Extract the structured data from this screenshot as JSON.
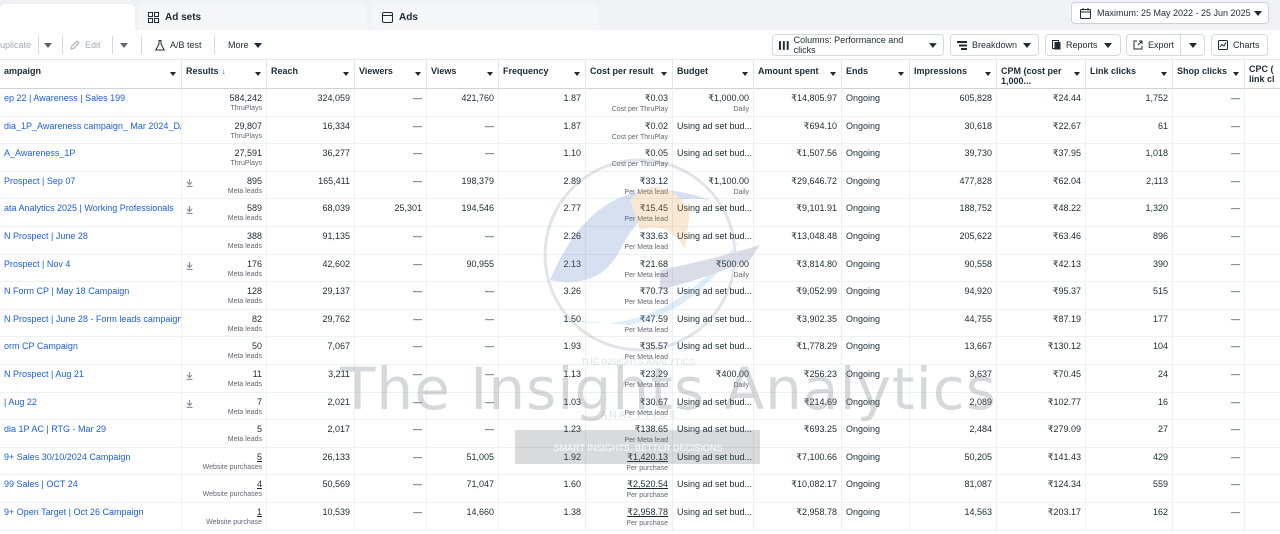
{
  "tabs": [
    {
      "label": "Ad sets",
      "icon": "grid-icon"
    },
    {
      "label": "Ads",
      "icon": "ad-icon"
    }
  ],
  "date_range": "Maximum: 25 May 2022 - 25 Jun 2025",
  "toolbar": {
    "duplicate": "uplicate",
    "edit": "Edit",
    "ab_test": "A/B test",
    "more": "More",
    "columns": "Columns: Performance and clicks",
    "breakdown": "Breakdown",
    "reports": "Reports",
    "export": "Export",
    "charts": "Charts"
  },
  "columns": [
    {
      "label": "ampaign"
    },
    {
      "label": "Results",
      "sort": "↓"
    },
    {
      "label": "Reach"
    },
    {
      "label": "Viewers"
    },
    {
      "label": "Views"
    },
    {
      "label": "Frequency"
    },
    {
      "label": "Cost per result"
    },
    {
      "label": "Budget"
    },
    {
      "label": "Amount spent"
    },
    {
      "label": "Ends"
    },
    {
      "label": "Impressions"
    },
    {
      "label": "CPM (cost per 1,000..."
    },
    {
      "label": "Link clicks"
    },
    {
      "label": "Shop clicks"
    },
    {
      "label": "CPC (\nlink cl"
    }
  ],
  "rows": [
    {
      "name": "ep 22 | Awareness | Sales 199",
      "lead": false,
      "results": "584,242",
      "results_sub": "ThruPlays",
      "reach": "324,059",
      "viewers": "—",
      "views": "421,760",
      "frequency": "1.87",
      "cpr": "₹0.03",
      "cpr_sub": "Cost per ThruPlay",
      "budget": "₹1,000.00",
      "budget_sub": "Daily",
      "spent": "₹14,805.97",
      "ends": "Ongoing",
      "impressions": "605,828",
      "cpm": "₹24.44",
      "link_clicks": "1,752",
      "shop_clicks": "—",
      "underline": false
    },
    {
      "name": "dia_1P_Awareness campaign_ Mar 2024_DA",
      "lead": false,
      "results": "29,807",
      "results_sub": "ThruPlays",
      "reach": "16,334",
      "viewers": "—",
      "views": "—",
      "frequency": "1.87",
      "cpr": "₹0.02",
      "cpr_sub": "Cost per ThruPlay",
      "budget": "Using ad set bud...",
      "budget_sub": "",
      "spent": "₹694.10",
      "ends": "Ongoing",
      "impressions": "30,618",
      "cpm": "₹22.67",
      "link_clicks": "61",
      "shop_clicks": "—",
      "underline": false
    },
    {
      "name": "A_Awareness_1P",
      "lead": false,
      "results": "27,591",
      "results_sub": "ThruPlays",
      "reach": "36,277",
      "viewers": "—",
      "views": "—",
      "frequency": "1.10",
      "cpr": "₹0.05",
      "cpr_sub": "Cost per ThruPlay",
      "budget": "Using ad set bud...",
      "budget_sub": "",
      "spent": "₹1,507.56",
      "ends": "Ongoing",
      "impressions": "39,730",
      "cpm": "₹37.95",
      "link_clicks": "1,018",
      "shop_clicks": "—",
      "underline": false
    },
    {
      "name": "Prospect | Sep 07",
      "lead": true,
      "results": "895",
      "results_sub": "Meta leads",
      "reach": "165,411",
      "viewers": "—",
      "views": "198,379",
      "frequency": "2.89",
      "cpr": "₹33.12",
      "cpr_sub": "Per Meta lead",
      "budget": "₹1,100.00",
      "budget_sub": "Daily",
      "spent": "₹29,646.72",
      "ends": "Ongoing",
      "impressions": "477,828",
      "cpm": "₹62.04",
      "link_clicks": "2,113",
      "shop_clicks": "—",
      "underline": false
    },
    {
      "name": "ata Analytics 2025 | Working Professionals",
      "lead": true,
      "results": "589",
      "results_sub": "Meta leads",
      "reach": "68,039",
      "viewers": "25,301",
      "views": "194,546",
      "frequency": "2.77",
      "cpr": "₹15.45",
      "cpr_sub": "Per Meta lead",
      "budget": "Using ad set bud...",
      "budget_sub": "",
      "spent": "₹9,101.91",
      "ends": "Ongoing",
      "impressions": "188,752",
      "cpm": "₹48.22",
      "link_clicks": "1,320",
      "shop_clicks": "—",
      "underline": false
    },
    {
      "name": "N Prospect | June 28",
      "lead": false,
      "results": "388",
      "results_sub": "Meta leads",
      "reach": "91,135",
      "viewers": "—",
      "views": "—",
      "frequency": "2.26",
      "cpr": "₹33.63",
      "cpr_sub": "Per Meta lead",
      "budget": "Using ad set bud...",
      "budget_sub": "",
      "spent": "₹13,048.48",
      "ends": "Ongoing",
      "impressions": "205,622",
      "cpm": "₹63.46",
      "link_clicks": "896",
      "shop_clicks": "—",
      "underline": false
    },
    {
      "name": "Prospect | Nov 4",
      "lead": true,
      "results": "176",
      "results_sub": "Meta leads",
      "reach": "42,602",
      "viewers": "—",
      "views": "90,955",
      "frequency": "2.13",
      "cpr": "₹21.68",
      "cpr_sub": "Per Meta lead",
      "budget": "₹500.00",
      "budget_sub": "Daily",
      "spent": "₹3,814.80",
      "ends": "Ongoing",
      "impressions": "90,558",
      "cpm": "₹42.13",
      "link_clicks": "390",
      "shop_clicks": "—",
      "underline": false
    },
    {
      "name": "N Form CP | May 18 Campaign",
      "lead": false,
      "results": "128",
      "results_sub": "Meta leads",
      "reach": "29,137",
      "viewers": "—",
      "views": "—",
      "frequency": "3.26",
      "cpr": "₹70.73",
      "cpr_sub": "Per Meta lead",
      "budget": "Using ad set bud...",
      "budget_sub": "",
      "spent": "₹9,052.99",
      "ends": "Ongoing",
      "impressions": "94,920",
      "cpm": "₹95.37",
      "link_clicks": "515",
      "shop_clicks": "—",
      "underline": false
    },
    {
      "name": "N Prospect | June 28 - Form leads campaign -...",
      "lead": false,
      "results": "82",
      "results_sub": "Meta leads",
      "reach": "29,762",
      "viewers": "—",
      "views": "—",
      "frequency": "1.50",
      "cpr": "₹47.59",
      "cpr_sub": "Per Meta lead",
      "budget": "Using ad set bud...",
      "budget_sub": "",
      "spent": "₹3,902.35",
      "ends": "Ongoing",
      "impressions": "44,755",
      "cpm": "₹87.19",
      "link_clicks": "177",
      "shop_clicks": "—",
      "underline": false
    },
    {
      "name": "orm CP Campaign",
      "lead": false,
      "results": "50",
      "results_sub": "Meta leads",
      "reach": "7,067",
      "viewers": "—",
      "views": "—",
      "frequency": "1.93",
      "cpr": "₹35.57",
      "cpr_sub": "Per Meta lead",
      "budget": "Using ad set bud...",
      "budget_sub": "",
      "spent": "₹1,778.29",
      "ends": "Ongoing",
      "impressions": "13,667",
      "cpm": "₹130.12",
      "link_clicks": "104",
      "shop_clicks": "—",
      "underline": false
    },
    {
      "name": "N Prospect | Aug 21",
      "lead": true,
      "results": "11",
      "results_sub": "Meta leads",
      "reach": "3,211",
      "viewers": "—",
      "views": "—",
      "frequency": "1.13",
      "cpr": "₹23.29",
      "cpr_sub": "Per Meta lead",
      "budget": "₹400.00",
      "budget_sub": "Daily",
      "spent": "₹256.23",
      "ends": "Ongoing",
      "impressions": "3,637",
      "cpm": "₹70.45",
      "link_clicks": "24",
      "shop_clicks": "—",
      "underline": false
    },
    {
      "name": "| Aug 22",
      "lead": true,
      "results": "7",
      "results_sub": "Meta leads",
      "reach": "2,021",
      "viewers": "—",
      "views": "—",
      "frequency": "1.03",
      "cpr": "₹30.67",
      "cpr_sub": "Per Meta lead",
      "budget": "Using ad set bud...",
      "budget_sub": "",
      "spent": "₹214.69",
      "ends": "Ongoing",
      "impressions": "2,089",
      "cpm": "₹102.77",
      "link_clicks": "16",
      "shop_clicks": "—",
      "underline": false
    },
    {
      "name": "dia 1P AC | RTG - Mar 29",
      "lead": false,
      "results": "5",
      "results_sub": "Meta leads",
      "reach": "2,017",
      "viewers": "—",
      "views": "—",
      "frequency": "1.23",
      "cpr": "₹138.65",
      "cpr_sub": "Per Meta lead",
      "budget": "Using ad set bud...",
      "budget_sub": "",
      "spent": "₹693.25",
      "ends": "Ongoing",
      "impressions": "2,484",
      "cpm": "₹279.09",
      "link_clicks": "27",
      "shop_clicks": "—",
      "underline": false
    },
    {
      "name": "9+ Sales 30/10/2024 Campaign",
      "lead": false,
      "results": "5",
      "results_sub": "Website purchases",
      "reach": "26,133",
      "viewers": "—",
      "views": "51,005",
      "frequency": "1.92",
      "cpr": "₹1,420.13",
      "cpr_sub": "Per purchase",
      "budget": "Using ad set bud...",
      "budget_sub": "",
      "spent": "₹7,100.66",
      "ends": "Ongoing",
      "impressions": "50,205",
      "cpm": "₹141.43",
      "link_clicks": "429",
      "shop_clicks": "—",
      "underline": true
    },
    {
      "name": "99 Sales | OCT 24",
      "lead": false,
      "results": "4",
      "results_sub": "Website purchases",
      "reach": "50,569",
      "viewers": "—",
      "views": "71,047",
      "frequency": "1.60",
      "cpr": "₹2,520.54",
      "cpr_sub": "Per purchase",
      "budget": "Using ad set bud...",
      "budget_sub": "",
      "spent": "₹10,082.17",
      "ends": "Ongoing",
      "impressions": "81,087",
      "cpm": "₹124.34",
      "link_clicks": "559",
      "shop_clicks": "—",
      "underline": true
    },
    {
      "name": "9+ Open Target | Oct 26 Campaign",
      "lead": false,
      "results": "1",
      "results_sub": "Website purchase",
      "reach": "10,539",
      "viewers": "—",
      "views": "14,660",
      "frequency": "1.38",
      "cpr": "₹2,958.78",
      "cpr_sub": "Per purchase",
      "budget": "Using ad set bud...",
      "budget_sub": "",
      "spent": "₹2,958.78",
      "ends": "Ongoing",
      "impressions": "14,563",
      "cpm": "₹203.17",
      "link_clicks": "162",
      "shop_clicks": "—",
      "underline": true
    }
  ],
  "watermark": {
    "text": "The Insights Analytics",
    "logo_text_top": "THE INSIGHTS ANALYTICS",
    "logo_text_mid": "A N A L Y T I C S",
    "logo_ribbon": "SMART INSIGHTS, BETTER DECISIONS"
  }
}
